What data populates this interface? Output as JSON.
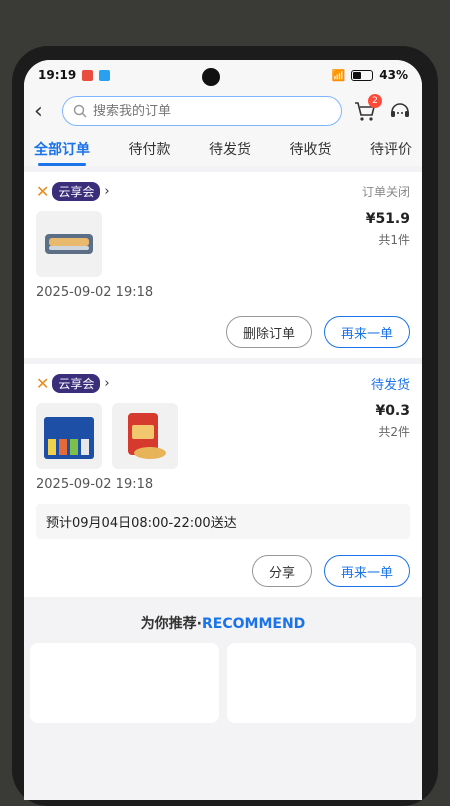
{
  "status_bar": {
    "time": "19:19",
    "battery": "43%"
  },
  "search": {
    "placeholder": "搜索我的订单"
  },
  "cart": {
    "badge": "2"
  },
  "tabs": [
    "全部订单",
    "待付款",
    "待发货",
    "待收货",
    "待评价"
  ],
  "orders": [
    {
      "shop": "云享会",
      "status": "订单关闭",
      "price": "¥51.9",
      "count": "共1件",
      "date": "2025-09-02 19:18",
      "buttons": [
        "删除订单",
        "再来一单"
      ]
    },
    {
      "shop": "云享会",
      "status": "待发货",
      "price": "¥0.3",
      "count": "共2件",
      "date": "2025-09-02 19:18",
      "eta": "预计09月04日08:00-22:00送达",
      "buttons": [
        "分享",
        "再来一单"
      ]
    }
  ],
  "recommend": {
    "cn": "为你推荐·",
    "en": "RECOMMEND"
  },
  "colors": {
    "accent": "#1a73e8",
    "badge": "#ff4a3a",
    "shop_tag": "#3a2e7a"
  }
}
